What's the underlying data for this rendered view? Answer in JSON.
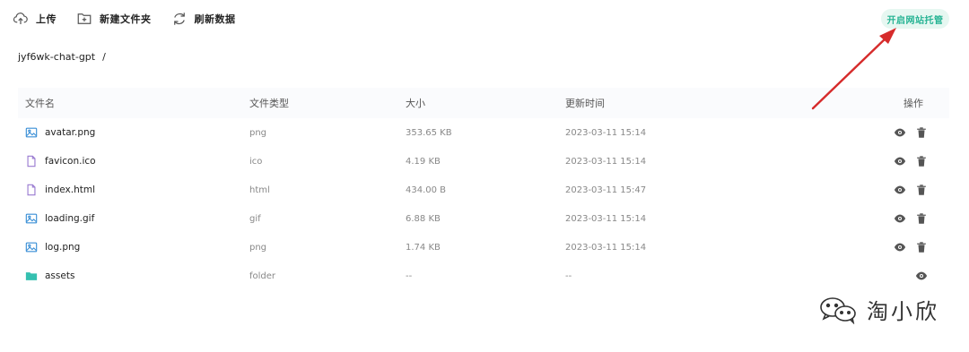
{
  "toolbar": {
    "upload_label": "上传",
    "new_folder_label": "新建文件夹",
    "refresh_label": "刷新数据"
  },
  "host_button_label": "开启网站托管",
  "breadcrumb": {
    "path": "jyf6wk-chat-gpt",
    "separator": "/"
  },
  "table": {
    "headers": {
      "name": "文件名",
      "type": "文件类型",
      "size": "大小",
      "time": "更新时间",
      "ops": "操作"
    },
    "rows": [
      {
        "name": "avatar.png",
        "type": "png",
        "size": "353.65 KB",
        "time": "2023-03-11 15:14",
        "icon": "image-icon"
      },
      {
        "name": "favicon.ico",
        "type": "ico",
        "size": "4.19 KB",
        "time": "2023-03-11 15:14",
        "icon": "file-icon"
      },
      {
        "name": "index.html",
        "type": "html",
        "size": "434.00 B",
        "time": "2023-03-11 15:47",
        "icon": "file-icon"
      },
      {
        "name": "loading.gif",
        "type": "gif",
        "size": "6.88 KB",
        "time": "2023-03-11 15:14",
        "icon": "image-icon"
      },
      {
        "name": "log.png",
        "type": "png",
        "size": "1.74 KB",
        "time": "2023-03-11 15:14",
        "icon": "image-icon"
      },
      {
        "name": "assets",
        "type": "folder",
        "size": "--",
        "time": "--",
        "icon": "folder-icon"
      }
    ]
  },
  "watermark": {
    "text": "淘小欣"
  },
  "colors": {
    "accent": "#25b393",
    "accent_bg": "#e6f7f1",
    "icon_blue": "#3a8fd6",
    "arrow_red": "#d62b2b",
    "folder_teal": "#35c0b0"
  }
}
